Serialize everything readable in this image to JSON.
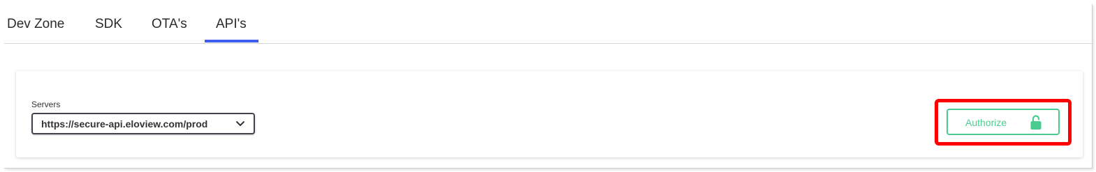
{
  "tabs": [
    {
      "label": "Dev Zone"
    },
    {
      "label": "SDK"
    },
    {
      "label": "OTA's"
    },
    {
      "label": "API's"
    }
  ],
  "active_tab": "API's",
  "servers": {
    "label": "Servers",
    "selected": "https://secure-api.eloview.com/prod"
  },
  "authorize": {
    "label": "Authorize",
    "icon": "lock-open-icon"
  },
  "colors": {
    "accent_tab": "#3d5cf0",
    "authorize_green": "#49cc90",
    "highlight_red": "#ff0000"
  }
}
